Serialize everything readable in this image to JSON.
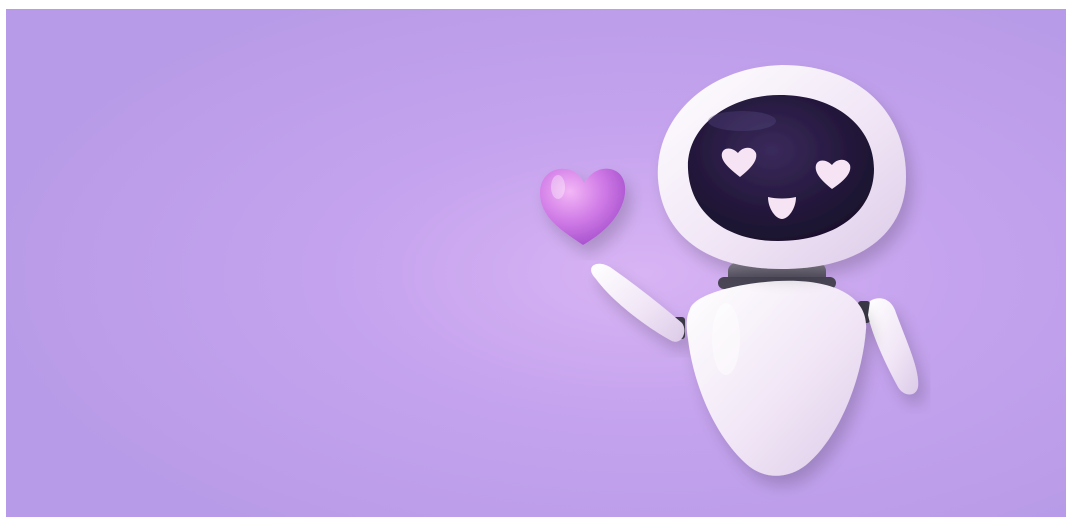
{
  "scene": {
    "subject": "robot",
    "background_color": "#b89be8",
    "glow_color": "#d8b4f4",
    "robot_shell_color": "#f4ecf8",
    "visor_color": "#1f1533",
    "face_light_color": "#f6e3f3",
    "heart_color": "#c36be0"
  }
}
